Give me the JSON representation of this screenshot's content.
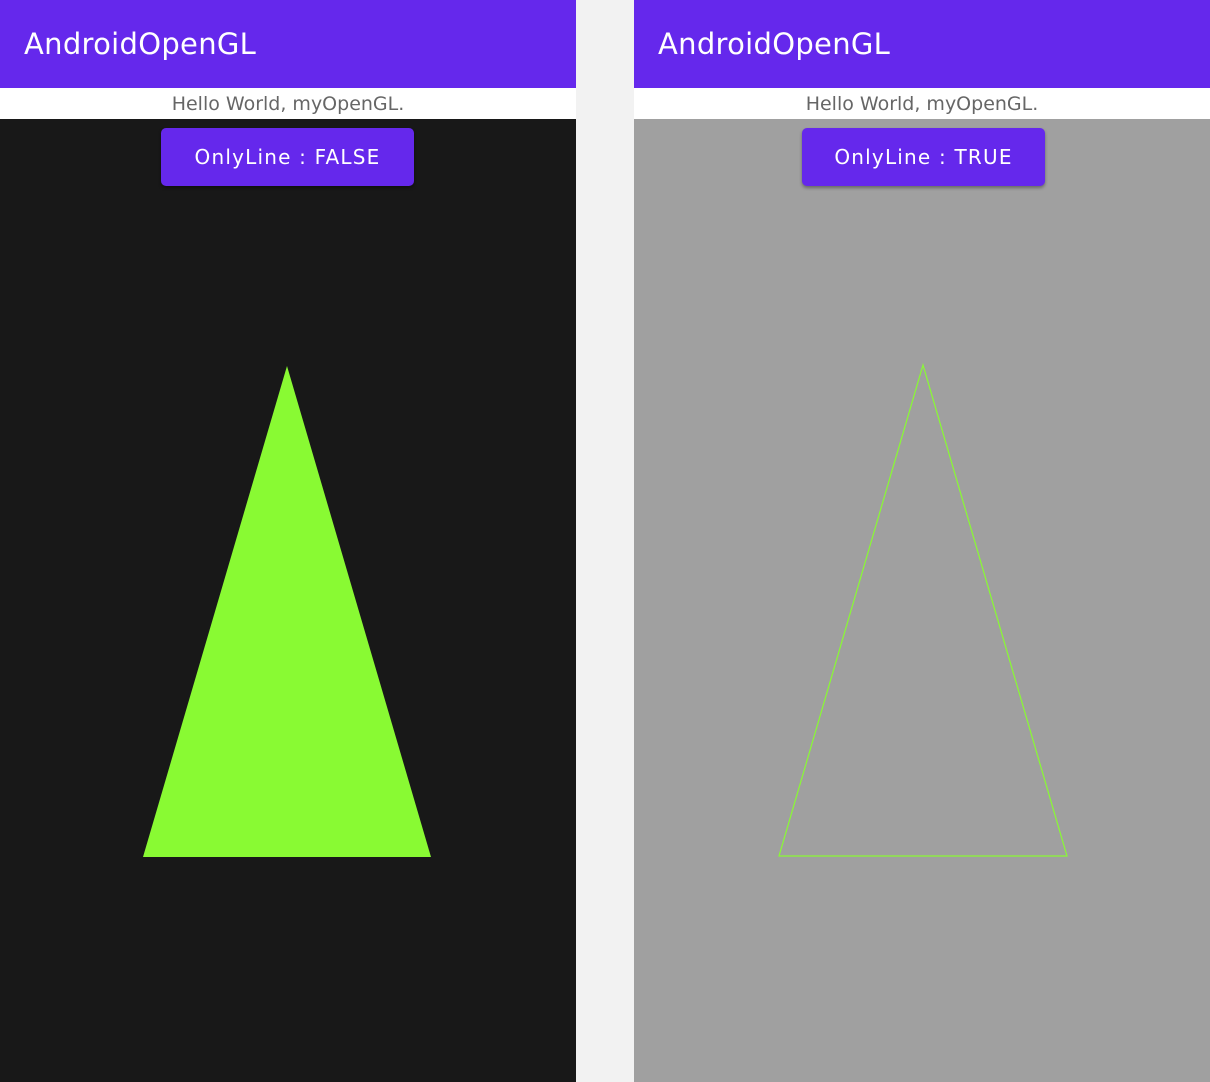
{
  "colors": {
    "app_bar": "#6528ec",
    "button": "#6528ec",
    "triangle": "#89fa33",
    "left_surface": "#181818",
    "right_surface": "#a0a0a0",
    "gap": "#f2f2f2"
  },
  "screens": [
    {
      "app_title": "AndroidOpenGL",
      "hello_text": "Hello World, myOpenGL.",
      "button_label": "OnlyLine : FALSE",
      "only_line": false
    },
    {
      "app_title": "AndroidOpenGL",
      "hello_text": "Hello World, myOpenGL.",
      "button_label": "OnlyLine : TRUE",
      "only_line": true
    }
  ]
}
